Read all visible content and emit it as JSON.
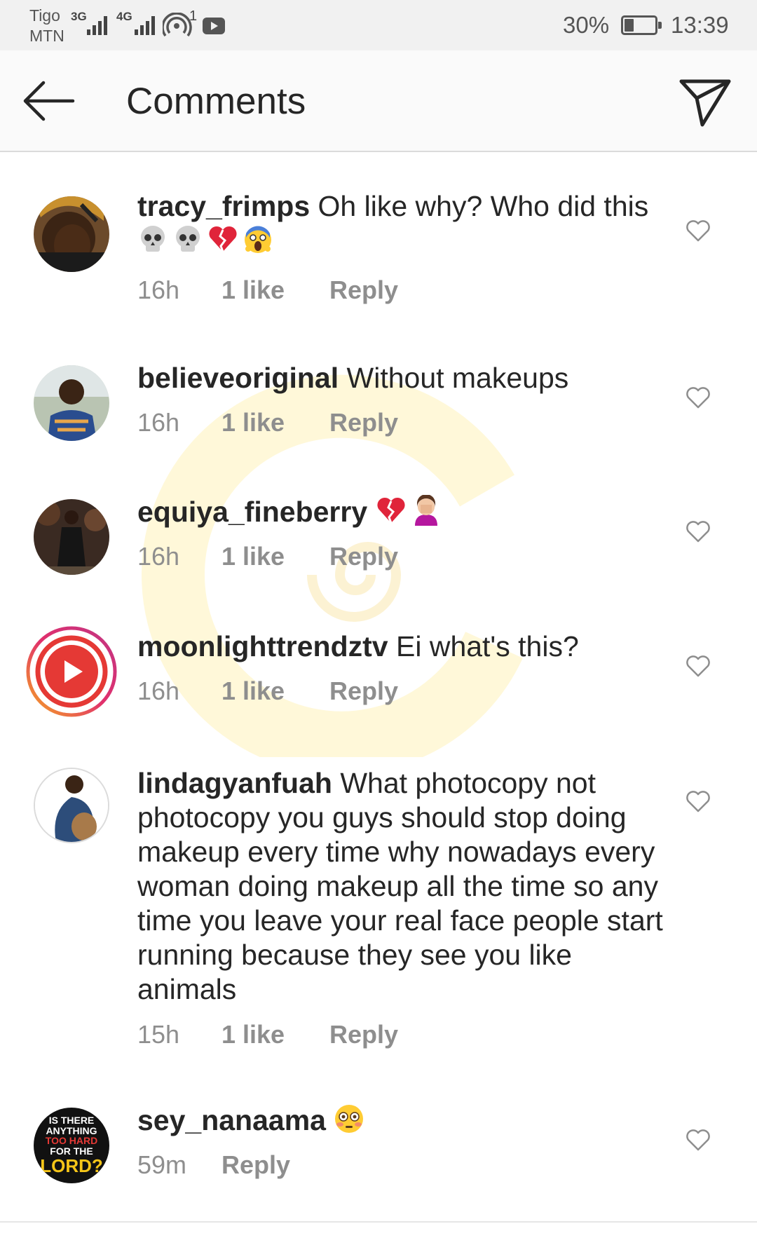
{
  "status_bar": {
    "carrier_1": "Tigo",
    "carrier_2": "MTN",
    "network_1": "3G",
    "network_2": "4G",
    "hotspot_badge": "1",
    "battery": "30%",
    "battery_level": 0.3,
    "time": "13:39"
  },
  "header": {
    "title": "Comments",
    "back_icon": "arrow-left-icon",
    "send_icon": "direct-send-icon"
  },
  "comments": [
    {
      "username": "tracy_frimps",
      "text": "Oh like why? Who did this",
      "emojis": [
        "skull",
        "skull",
        "broken-heart",
        "screaming-face"
      ],
      "time": "16h",
      "likes": "1 like",
      "reply": "Reply"
    },
    {
      "username": "believeoriginal",
      "text": "Without makeups",
      "time": "16h",
      "likes": "1 like",
      "reply": "Reply"
    },
    {
      "username": "equiya_fineberry",
      "text": "",
      "emojis": [
        "broken-heart",
        "woman-facepalming"
      ],
      "time": "16h",
      "likes": "1 like",
      "reply": "Reply"
    },
    {
      "username": "moonlighttrendztv",
      "text": "Ei what's this?",
      "time": "16h",
      "likes": "1 like",
      "reply": "Reply"
    },
    {
      "username": "lindagyanfuah",
      "text": "What photocopy not photocopy you guys should stop doing makeup every time why nowadays every woman doing makeup all the time so any time you leave your real face people start running because they see you like animals",
      "time": "15h",
      "likes": "1 like",
      "reply": "Reply"
    },
    {
      "username": "sey_nanaama",
      "text": "",
      "emojis": [
        "flushed-face"
      ],
      "time": "59m",
      "reply": "Reply",
      "avatar_text": [
        "IS THERE",
        "ANYTHING",
        "TOO HARD",
        "FOR THE",
        "LORD?"
      ]
    }
  ],
  "colors": {
    "text": "#262626",
    "meta": "#8e8e8e",
    "divider": "#dbdbdb",
    "live_ring": "#e1306c",
    "live_play": "#e53935"
  }
}
